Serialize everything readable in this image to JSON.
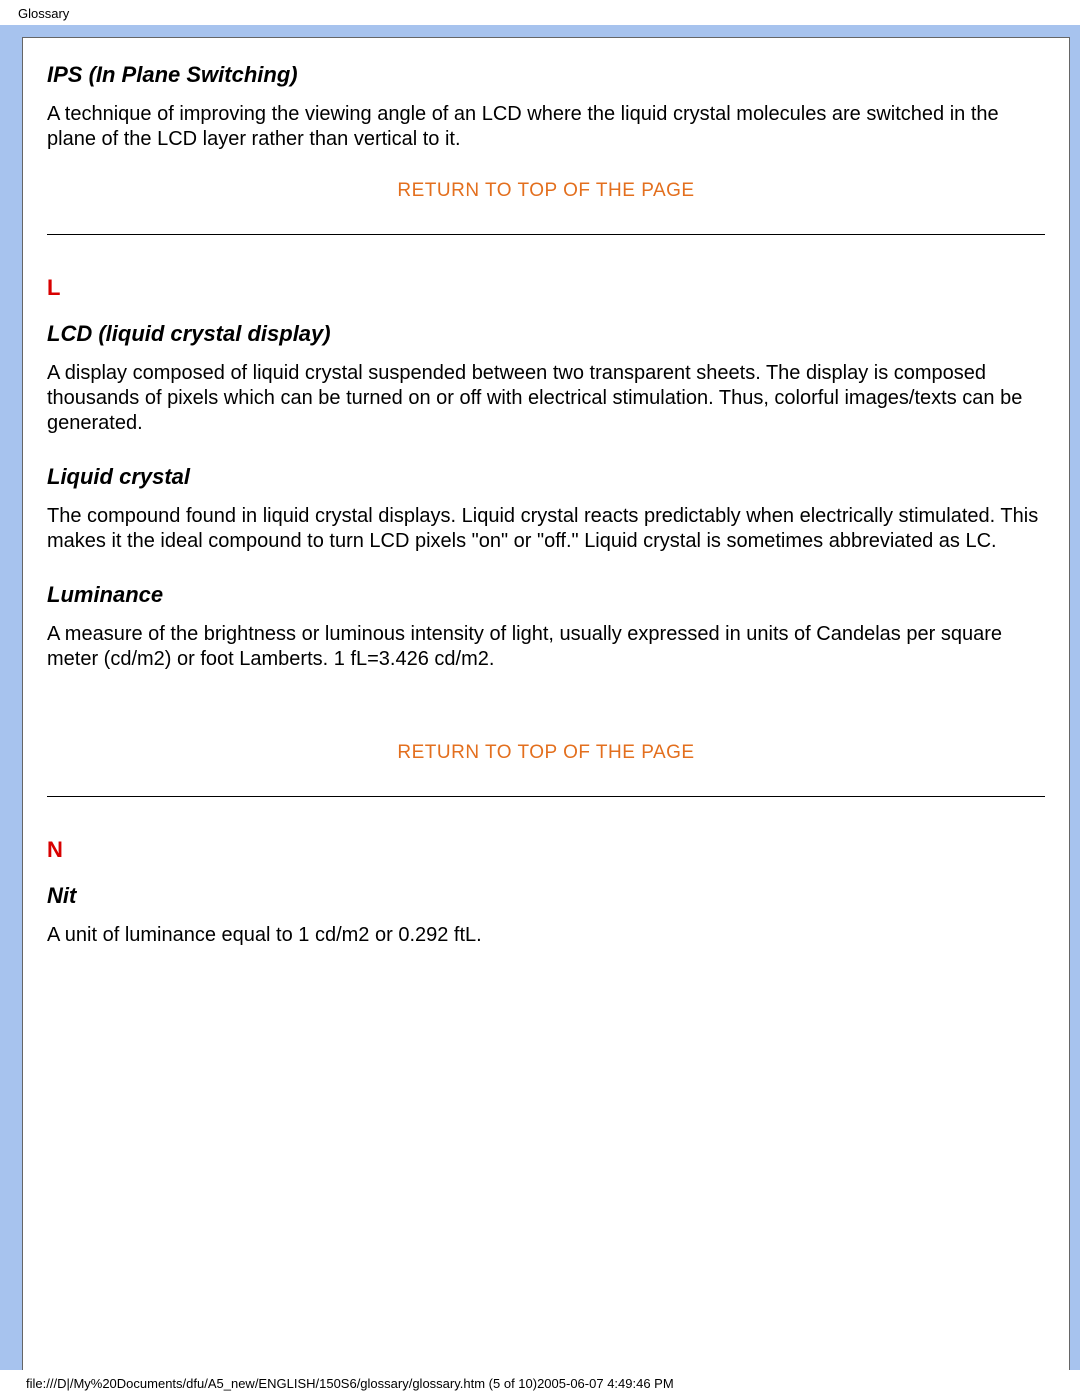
{
  "header": "Glossary",
  "entries": {
    "ips": {
      "title": "IPS (In Plane Switching)",
      "body": "A technique of improving the viewing angle of an LCD where the liquid crystal molecules are switched in the plane of the LCD layer rather than vertical to it."
    },
    "lcd": {
      "title": "LCD (liquid crystal display)",
      "body": "A display composed of liquid crystal suspended between two transparent sheets. The display is composed thousands of pixels which can be turned on or off with electrical stimulation. Thus, colorful images/texts can be generated."
    },
    "liquid_crystal": {
      "title": "Liquid crystal",
      "body": "The compound found in liquid crystal displays. Liquid crystal reacts predictably when electrically stimulated. This makes it the ideal compound to turn LCD pixels \"on\" or \"off.\" Liquid crystal is sometimes abbreviated as LC."
    },
    "luminance": {
      "title": "Luminance",
      "body": "A measure of the brightness or luminous intensity of light, usually expressed in units of Candelas per square meter (cd/m2) or foot Lamberts. 1 fL=3.426 cd/m2."
    },
    "nit": {
      "title": "Nit",
      "body": "A unit of luminance equal to 1 cd/m2 or 0.292 ftL."
    }
  },
  "letters": {
    "L": "L",
    "N": "N"
  },
  "return_link": "RETURN TO TOP OF THE PAGE",
  "footer": "file:///D|/My%20Documents/dfu/A5_new/ENGLISH/150S6/glossary/glossary.htm (5 of 10)2005-06-07 4:49:46 PM"
}
